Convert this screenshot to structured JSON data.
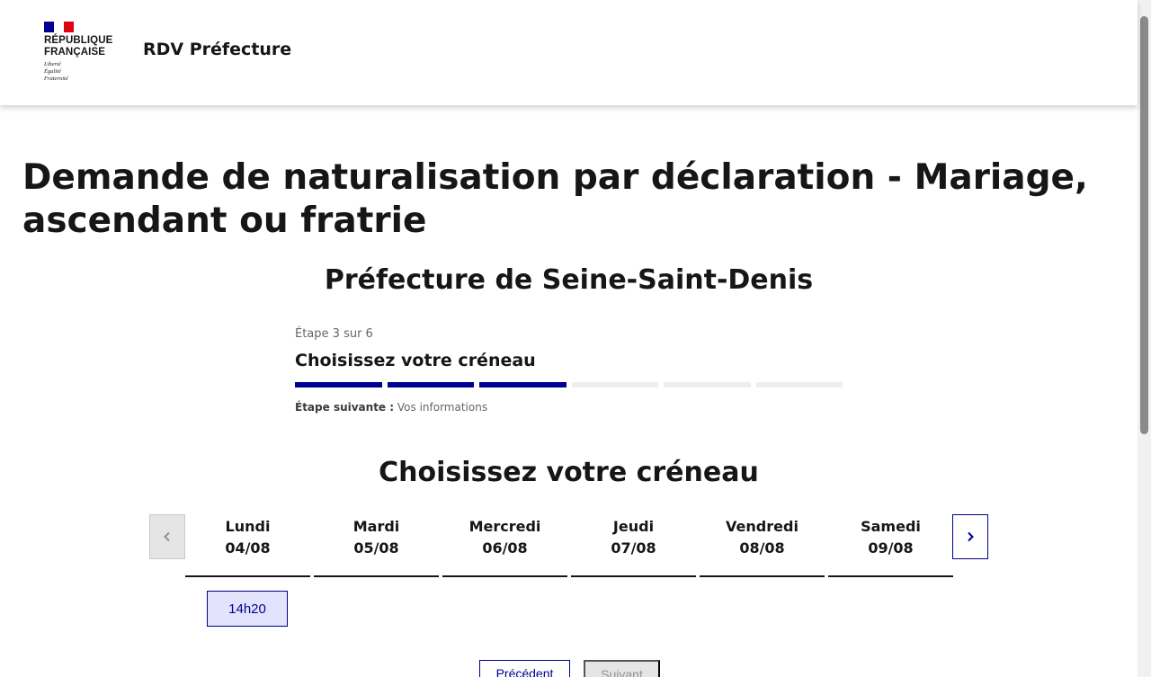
{
  "header": {
    "marianne_lines": [
      "République",
      "Française"
    ],
    "devise": [
      "Liberté",
      "Égalité",
      "Fraternité"
    ],
    "service_name": "RDV Préfecture"
  },
  "page": {
    "title": "Demande de naturalisation par déclaration - Mariage, ascendant ou fratrie",
    "prefecture": "Préfecture de Seine-Saint-Denis"
  },
  "stepper": {
    "state": "Étape 3 sur 6",
    "current_title": "Choisissez votre créneau",
    "current_step": 3,
    "total_steps": 6,
    "next_label": "Étape suivante :",
    "next_value": "Vos informations"
  },
  "calendar": {
    "title": "Choisissez votre créneau",
    "days": [
      {
        "name": "Lundi",
        "date": "04/08"
      },
      {
        "name": "Mardi",
        "date": "05/08"
      },
      {
        "name": "Mercredi",
        "date": "06/08"
      },
      {
        "name": "Jeudi",
        "date": "07/08"
      },
      {
        "name": "Vendredi",
        "date": "08/08"
      },
      {
        "name": "Samedi",
        "date": "09/08"
      }
    ],
    "slot": "14h20"
  },
  "actions": {
    "previous": "Précédent",
    "next": "Suivant"
  },
  "colors": {
    "blue_france": "#000091",
    "red_marianne": "#e1000f",
    "slot_bg": "#e3e3fd"
  }
}
